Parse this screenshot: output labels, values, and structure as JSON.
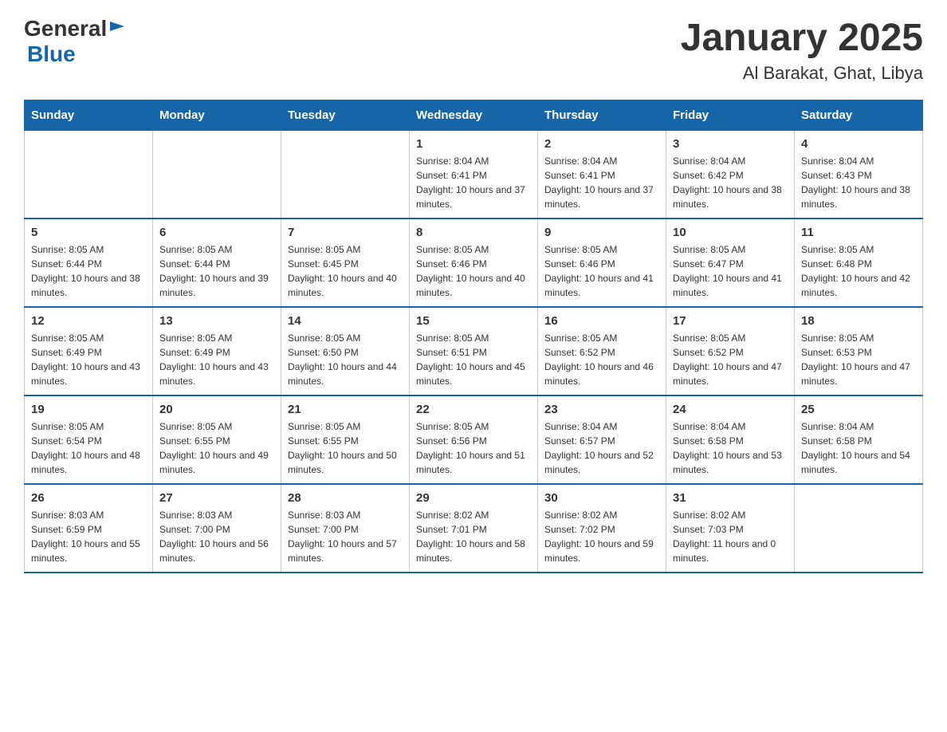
{
  "header": {
    "logo_general": "General",
    "logo_blue": "Blue",
    "month_year": "January 2025",
    "location": "Al Barakat, Ghat, Libya"
  },
  "days_of_week": [
    "Sunday",
    "Monday",
    "Tuesday",
    "Wednesday",
    "Thursday",
    "Friday",
    "Saturday"
  ],
  "weeks": [
    [
      {
        "day": "",
        "info": ""
      },
      {
        "day": "",
        "info": ""
      },
      {
        "day": "",
        "info": ""
      },
      {
        "day": "1",
        "info": "Sunrise: 8:04 AM\nSunset: 6:41 PM\nDaylight: 10 hours and 37 minutes."
      },
      {
        "day": "2",
        "info": "Sunrise: 8:04 AM\nSunset: 6:41 PM\nDaylight: 10 hours and 37 minutes."
      },
      {
        "day": "3",
        "info": "Sunrise: 8:04 AM\nSunset: 6:42 PM\nDaylight: 10 hours and 38 minutes."
      },
      {
        "day": "4",
        "info": "Sunrise: 8:04 AM\nSunset: 6:43 PM\nDaylight: 10 hours and 38 minutes."
      }
    ],
    [
      {
        "day": "5",
        "info": "Sunrise: 8:05 AM\nSunset: 6:44 PM\nDaylight: 10 hours and 38 minutes."
      },
      {
        "day": "6",
        "info": "Sunrise: 8:05 AM\nSunset: 6:44 PM\nDaylight: 10 hours and 39 minutes."
      },
      {
        "day": "7",
        "info": "Sunrise: 8:05 AM\nSunset: 6:45 PM\nDaylight: 10 hours and 40 minutes."
      },
      {
        "day": "8",
        "info": "Sunrise: 8:05 AM\nSunset: 6:46 PM\nDaylight: 10 hours and 40 minutes."
      },
      {
        "day": "9",
        "info": "Sunrise: 8:05 AM\nSunset: 6:46 PM\nDaylight: 10 hours and 41 minutes."
      },
      {
        "day": "10",
        "info": "Sunrise: 8:05 AM\nSunset: 6:47 PM\nDaylight: 10 hours and 41 minutes."
      },
      {
        "day": "11",
        "info": "Sunrise: 8:05 AM\nSunset: 6:48 PM\nDaylight: 10 hours and 42 minutes."
      }
    ],
    [
      {
        "day": "12",
        "info": "Sunrise: 8:05 AM\nSunset: 6:49 PM\nDaylight: 10 hours and 43 minutes."
      },
      {
        "day": "13",
        "info": "Sunrise: 8:05 AM\nSunset: 6:49 PM\nDaylight: 10 hours and 43 minutes."
      },
      {
        "day": "14",
        "info": "Sunrise: 8:05 AM\nSunset: 6:50 PM\nDaylight: 10 hours and 44 minutes."
      },
      {
        "day": "15",
        "info": "Sunrise: 8:05 AM\nSunset: 6:51 PM\nDaylight: 10 hours and 45 minutes."
      },
      {
        "day": "16",
        "info": "Sunrise: 8:05 AM\nSunset: 6:52 PM\nDaylight: 10 hours and 46 minutes."
      },
      {
        "day": "17",
        "info": "Sunrise: 8:05 AM\nSunset: 6:52 PM\nDaylight: 10 hours and 47 minutes."
      },
      {
        "day": "18",
        "info": "Sunrise: 8:05 AM\nSunset: 6:53 PM\nDaylight: 10 hours and 47 minutes."
      }
    ],
    [
      {
        "day": "19",
        "info": "Sunrise: 8:05 AM\nSunset: 6:54 PM\nDaylight: 10 hours and 48 minutes."
      },
      {
        "day": "20",
        "info": "Sunrise: 8:05 AM\nSunset: 6:55 PM\nDaylight: 10 hours and 49 minutes."
      },
      {
        "day": "21",
        "info": "Sunrise: 8:05 AM\nSunset: 6:55 PM\nDaylight: 10 hours and 50 minutes."
      },
      {
        "day": "22",
        "info": "Sunrise: 8:05 AM\nSunset: 6:56 PM\nDaylight: 10 hours and 51 minutes."
      },
      {
        "day": "23",
        "info": "Sunrise: 8:04 AM\nSunset: 6:57 PM\nDaylight: 10 hours and 52 minutes."
      },
      {
        "day": "24",
        "info": "Sunrise: 8:04 AM\nSunset: 6:58 PM\nDaylight: 10 hours and 53 minutes."
      },
      {
        "day": "25",
        "info": "Sunrise: 8:04 AM\nSunset: 6:58 PM\nDaylight: 10 hours and 54 minutes."
      }
    ],
    [
      {
        "day": "26",
        "info": "Sunrise: 8:03 AM\nSunset: 6:59 PM\nDaylight: 10 hours and 55 minutes."
      },
      {
        "day": "27",
        "info": "Sunrise: 8:03 AM\nSunset: 7:00 PM\nDaylight: 10 hours and 56 minutes."
      },
      {
        "day": "28",
        "info": "Sunrise: 8:03 AM\nSunset: 7:00 PM\nDaylight: 10 hours and 57 minutes."
      },
      {
        "day": "29",
        "info": "Sunrise: 8:02 AM\nSunset: 7:01 PM\nDaylight: 10 hours and 58 minutes."
      },
      {
        "day": "30",
        "info": "Sunrise: 8:02 AM\nSunset: 7:02 PM\nDaylight: 10 hours and 59 minutes."
      },
      {
        "day": "31",
        "info": "Sunrise: 8:02 AM\nSunset: 7:03 PM\nDaylight: 11 hours and 0 minutes."
      },
      {
        "day": "",
        "info": ""
      }
    ]
  ]
}
